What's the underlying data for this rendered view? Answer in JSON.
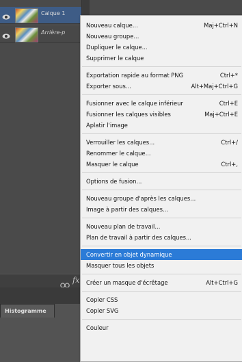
{
  "layers": [
    {
      "name": "Calque 1",
      "selected": true,
      "italic": false
    },
    {
      "name": "Arrière-p",
      "selected": false,
      "italic": true
    }
  ],
  "footer": {
    "link_icon": "link-icon",
    "fx_label": "fx"
  },
  "panel_tab": {
    "label": "Histogramme"
  },
  "menu": {
    "highlight_color": "#2b7bd7",
    "groups": [
      [
        {
          "label": "Nouveau calque...",
          "shortcut": "Maj+Ctrl+N"
        },
        {
          "label": "Nouveau groupe...",
          "shortcut": ""
        },
        {
          "label": "Dupliquer le calque...",
          "shortcut": ""
        },
        {
          "label": "Supprimer le calque",
          "shortcut": ""
        }
      ],
      [
        {
          "label": "Exportation rapide au format PNG",
          "shortcut": "Ctrl+*"
        },
        {
          "label": "Exporter sous...",
          "shortcut": "Alt+Maj+Ctrl+G"
        }
      ],
      [
        {
          "label": "Fusionner avec le calque inférieur",
          "shortcut": "Ctrl+E"
        },
        {
          "label": "Fusionner les calques visibles",
          "shortcut": "Maj+Ctrl+E"
        },
        {
          "label": "Aplatir l'image",
          "shortcut": ""
        }
      ],
      [
        {
          "label": "Verrouiller les calques...",
          "shortcut": "Ctrl+/"
        },
        {
          "label": "Renommer le calque...",
          "shortcut": ""
        },
        {
          "label": "Masquer le calque",
          "shortcut": "Ctrl+,"
        }
      ],
      [
        {
          "label": "Options de fusion...",
          "shortcut": ""
        }
      ],
      [
        {
          "label": "Nouveau groupe d'après les calques...",
          "shortcut": ""
        },
        {
          "label": "Image à partir des calques...",
          "shortcut": ""
        }
      ],
      [
        {
          "label": "Nouveau plan de travail...",
          "shortcut": ""
        },
        {
          "label": "Plan de travail à partir des calques...",
          "shortcut": ""
        }
      ],
      [
        {
          "label": "Convertir en objet dynamique",
          "shortcut": "",
          "highlighted": true
        },
        {
          "label": "Masquer tous les objets",
          "shortcut": ""
        }
      ],
      [
        {
          "label": "Créer un masque d'écrêtage",
          "shortcut": "Alt+Ctrl+G"
        }
      ],
      [
        {
          "label": "Copier CSS",
          "shortcut": ""
        },
        {
          "label": "Copier SVG",
          "shortcut": ""
        }
      ],
      [
        {
          "label": "Couleur",
          "shortcut": ""
        }
      ]
    ]
  }
}
